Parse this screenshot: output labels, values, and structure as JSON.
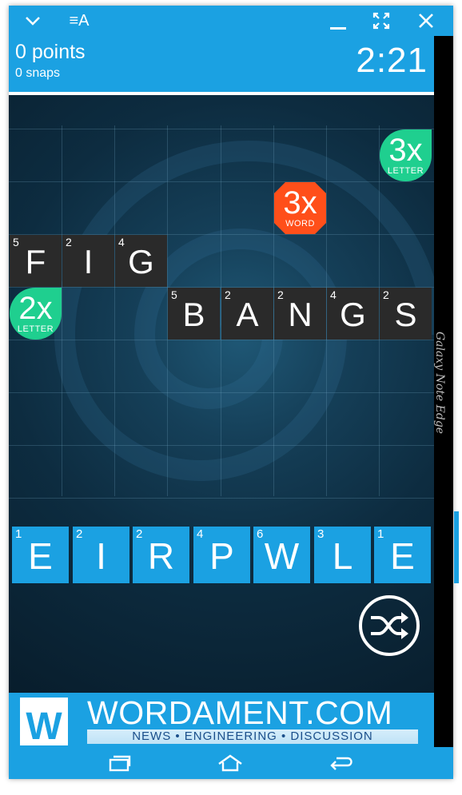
{
  "window": {
    "toolbar_icon_label": "≡A"
  },
  "header": {
    "points": "0 points",
    "snaps": "0 snaps",
    "timer": "2:21"
  },
  "board": {
    "bonuses": [
      {
        "big": "3x",
        "small": "LETTER",
        "color": "#1fcf8f"
      },
      {
        "big": "3x",
        "small": "WORD",
        "color": "#ff4f1a"
      },
      {
        "big": "2x",
        "small": "LETTER",
        "color": "#1fcf8f"
      }
    ],
    "words": [
      {
        "word": "FIG",
        "tiles": [
          {
            "letter": "F",
            "score": "5"
          },
          {
            "letter": "I",
            "score": "2"
          },
          {
            "letter": "G",
            "score": "4"
          }
        ]
      },
      {
        "word": "BANGS",
        "tiles": [
          {
            "letter": "B",
            "score": "5"
          },
          {
            "letter": "A",
            "score": "2"
          },
          {
            "letter": "N",
            "score": "2"
          },
          {
            "letter": "G",
            "score": "4"
          },
          {
            "letter": "S",
            "score": "2"
          }
        ]
      }
    ]
  },
  "rack": [
    {
      "letter": "E",
      "score": "1"
    },
    {
      "letter": "I",
      "score": "2"
    },
    {
      "letter": "R",
      "score": "2"
    },
    {
      "letter": "P",
      "score": "4"
    },
    {
      "letter": "W",
      "score": "6"
    },
    {
      "letter": "L",
      "score": "3"
    },
    {
      "letter": "E",
      "score": "1"
    }
  ],
  "banner": {
    "logo": "W",
    "title": "WORDAMENT.COM",
    "sub": "NEWS • ENGINEERING • DISCUSSION"
  },
  "device_label": "Galaxy Note Edge",
  "colors": {
    "accent": "#1ba1e2",
    "tile_dark": "#2a2a2a",
    "bonus_letter": "#1fcf8f",
    "bonus_word": "#ff4f1a"
  }
}
